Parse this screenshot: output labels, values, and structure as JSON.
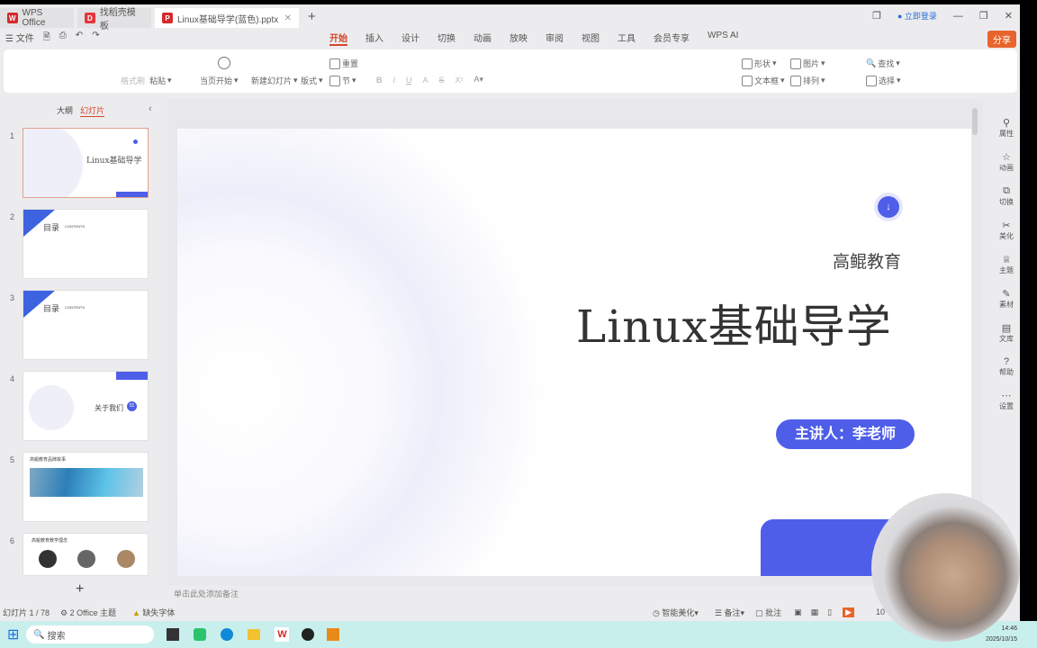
{
  "tabs": [
    {
      "label": "WPS Office",
      "color": "#d5292b",
      "icon": "W"
    },
    {
      "label": "找稻壳模板",
      "color": "#e5343c",
      "icon": "D"
    },
    {
      "label": "Linux基础导学(蓝色).pptx",
      "color": "#d5292b",
      "icon": "P"
    }
  ],
  "window": {
    "login": "立即登录"
  },
  "menu": {
    "file": "文件",
    "tabs": [
      "开始",
      "插入",
      "设计",
      "切换",
      "动画",
      "放映",
      "审阅",
      "视图",
      "工具",
      "会员专享",
      "WPS AI"
    ],
    "active": "开始",
    "share": "分享"
  },
  "ribbon": {
    "format_painter": "格式刷",
    "paste": "粘贴",
    "play_from_current": "当页开始",
    "new_slide": "新建幻灯片",
    "layout": "版式",
    "reset": "重置",
    "section": "节",
    "shape": "形状",
    "picture": "图片",
    "textbox": "文本框",
    "arrange": "排列",
    "find": "查找",
    "select": "选择"
  },
  "left_panel": {
    "outline_tab": "大纲",
    "slides_tab": "幻灯片",
    "slides": [
      {
        "num": "1",
        "title": "Linux基础导学",
        "subtitle": "高鲲教育"
      },
      {
        "num": "2",
        "title": "目录",
        "subtitle": "CONTENTS"
      },
      {
        "num": "3",
        "title": "目录",
        "subtitle": "CONTENTS"
      },
      {
        "num": "4",
        "title": "关于我们",
        "badge": "01"
      },
      {
        "num": "5",
        "title": "高鲲教育品牌故事"
      },
      {
        "num": "6",
        "title": "高鲲教育教学理念"
      }
    ],
    "add": "+"
  },
  "slide": {
    "org": "高鲲教育",
    "title": "Linux基础导学",
    "presenter": "主讲人：李老师",
    "accent": "#4f5ee8"
  },
  "notes_placeholder": "单击此处添加备注",
  "right_sidebar": [
    "属性",
    "动画",
    "切换",
    "美化",
    "主题",
    "素材",
    "文库",
    "帮助",
    "设置"
  ],
  "status": {
    "slide_count": "幻灯片 1 / 78",
    "theme": "2 Office 主题",
    "missing_font": "缺失字体",
    "smart": "智能美化",
    "notes": "备注",
    "comment": "批注",
    "zoom": "10"
  },
  "taskbar": {
    "search": "搜索",
    "time": "14:46",
    "date": "2025/10/15"
  }
}
